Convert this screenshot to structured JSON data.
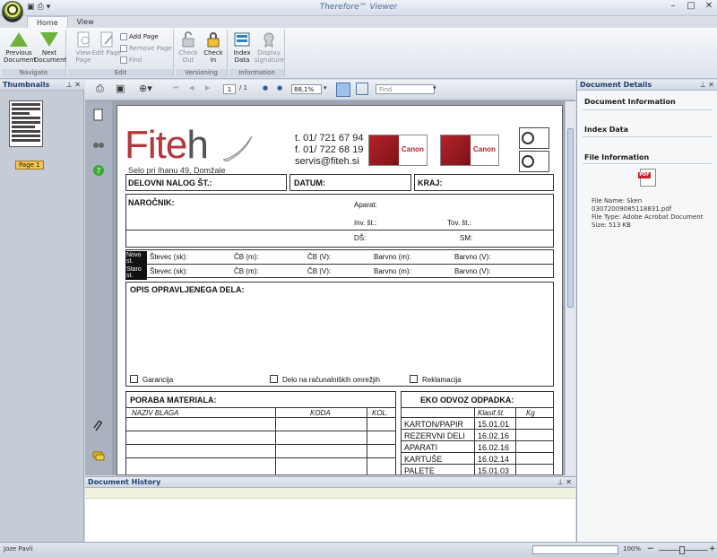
{
  "window": {
    "title": "Therefore™ Viewer"
  },
  "ribbon": {
    "tabs": [
      "Home",
      "View"
    ],
    "navigate": {
      "label": "Navigate",
      "previous": "Previous Document",
      "next": "Next Document"
    },
    "edit": {
      "label": "Edit",
      "view_page": "View Page",
      "edit_page": "Edit Page",
      "add_page": "Add Page",
      "remove_page": "Remove Page",
      "find": "Find"
    },
    "versioning": {
      "label": "Versioning",
      "check_out": "Check Out",
      "check_in": "Check In"
    },
    "information": {
      "label": "Information",
      "index_data": "Index Data",
      "display_signature": "Display signature"
    }
  },
  "thumbnails": {
    "title": "Thumbnails",
    "page_label": "Page 1"
  },
  "viewer_toolbar": {
    "page_current": "1",
    "page_total": "/ 1",
    "zoom": "88,1%",
    "find_placeholder": "Find"
  },
  "document": {
    "logo_main": "Fite",
    "logo_tail": "h",
    "tagline": "Selo pri Ihanu 49, Domžale",
    "phone": "t. 01/ 721 67 94",
    "fax": "f. 01/ 722 68 19",
    "email": "servis@fiteh.si",
    "canon1": "Canon",
    "canon2": "Canon",
    "row1": {
      "delovni": "DELOVNI NALOG ŠT.:",
      "datum": "DATUM:",
      "kraj": "KRAJ:"
    },
    "narocnik": "NAROČNIK:",
    "aparat": "Aparat:",
    "inv": "Inv. št.:",
    "tov": "Tov. št.:",
    "ds": "DŠ:",
    "sm": "SM:",
    "novo": "Novo st.",
    "staro": "Staro st.",
    "stevec": "Števec (sk):",
    "cbm": "ČB (m):",
    "cbv": "ČB (V):",
    "barvm": "Barvno (m):",
    "barvv": "Barvno (V):",
    "opis": "OPIS OPRAVLJENEGA DELA:",
    "garancija": "Garancija",
    "omrezje": "Delo na računalniških omrežjih",
    "reklamacija": "Reklamacija",
    "poraba": "PORABA MATERIALA:",
    "naziv": "NAZIV BLAGA",
    "koda": "KODA",
    "kol": "KOL.",
    "eko": "EKO ODVOZ ODPADKA:",
    "klasif": "Klasif.št.",
    "kg": "Kg",
    "waste": [
      {
        "name": "KARTON/PAPIR",
        "code": "15.01.01"
      },
      {
        "name": "REZERVNI DELI",
        "code": "16.02.16"
      },
      {
        "name": "APARATI",
        "code": "16.02.16"
      },
      {
        "name": "KARTUŠE",
        "code": "16.02.14"
      },
      {
        "name": "PALETE",
        "code": "15.01.03"
      }
    ]
  },
  "details": {
    "title": "Document Details",
    "doc_info": "Document Information",
    "index_data": "Index Data",
    "file_info": "File Information",
    "file_name_label": "File Name: Sken",
    "file_name_value": "03072009085118831.pdf",
    "file_type": "File Type: Adobe Acrobat Document",
    "size": "Size: 513 KB"
  },
  "history": {
    "title": "Document History"
  },
  "status": {
    "user": "Joze Pavli",
    "zoom": "100%"
  }
}
